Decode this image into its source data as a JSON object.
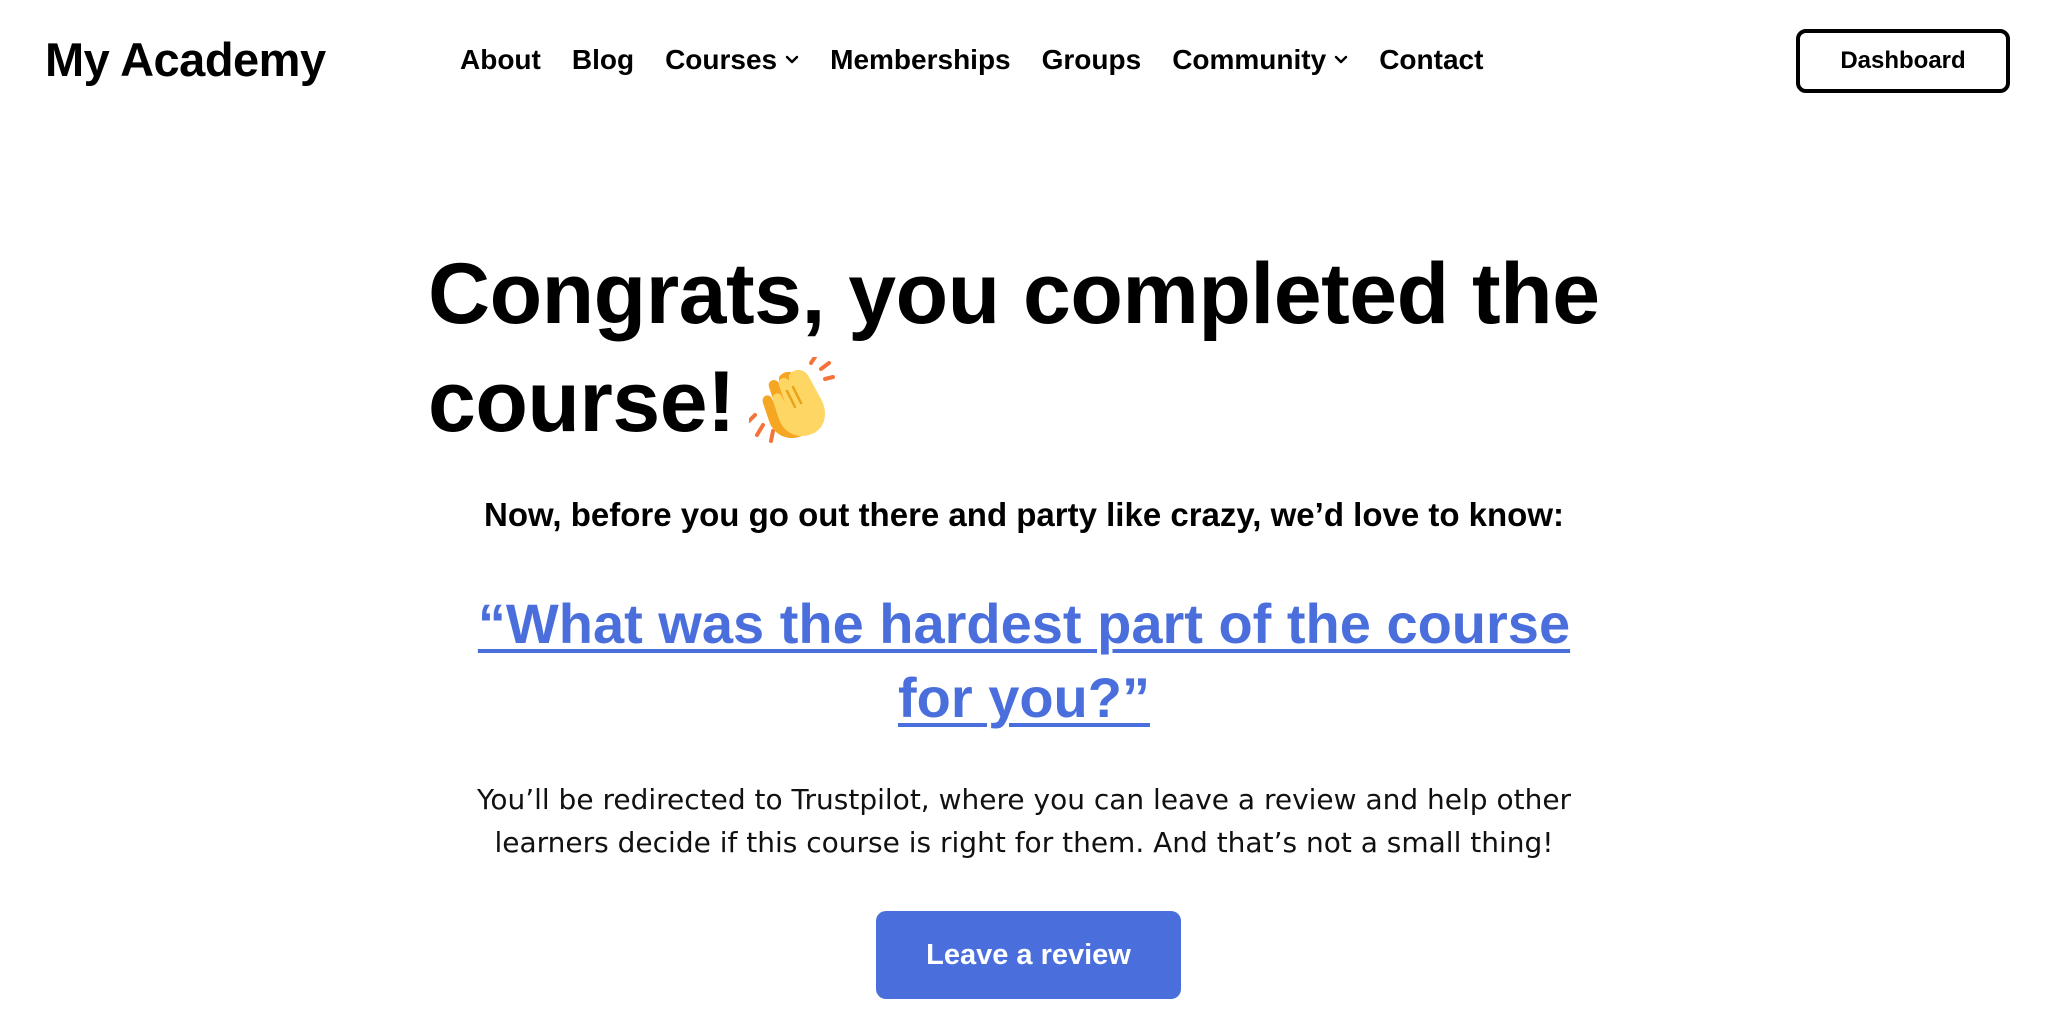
{
  "header": {
    "logo": "My Academy",
    "nav": [
      {
        "label": "About",
        "has_dropdown": false
      },
      {
        "label": "Blog",
        "has_dropdown": false
      },
      {
        "label": "Courses",
        "has_dropdown": true
      },
      {
        "label": "Memberships",
        "has_dropdown": false
      },
      {
        "label": "Groups",
        "has_dropdown": false
      },
      {
        "label": "Community",
        "has_dropdown": true
      },
      {
        "label": "Contact",
        "has_dropdown": false
      }
    ],
    "dashboard_label": "Dashboard"
  },
  "main": {
    "headline": "Congrats, you completed the course!",
    "headline_icon": "clapping-hands-icon",
    "subtitle": "Now, before you go out there and party like crazy, we’d love to know:",
    "question": "“What was the hardest part of the course for you?”",
    "description": "You’ll be redirected to Trustpilot, where you can leave a review and help other learners decide if this course is right for them. And that’s not a small thing!",
    "review_button_label": "Leave a review"
  },
  "colors": {
    "accent": "#4a6fdc",
    "text": "#000000",
    "background": "#ffffff"
  }
}
